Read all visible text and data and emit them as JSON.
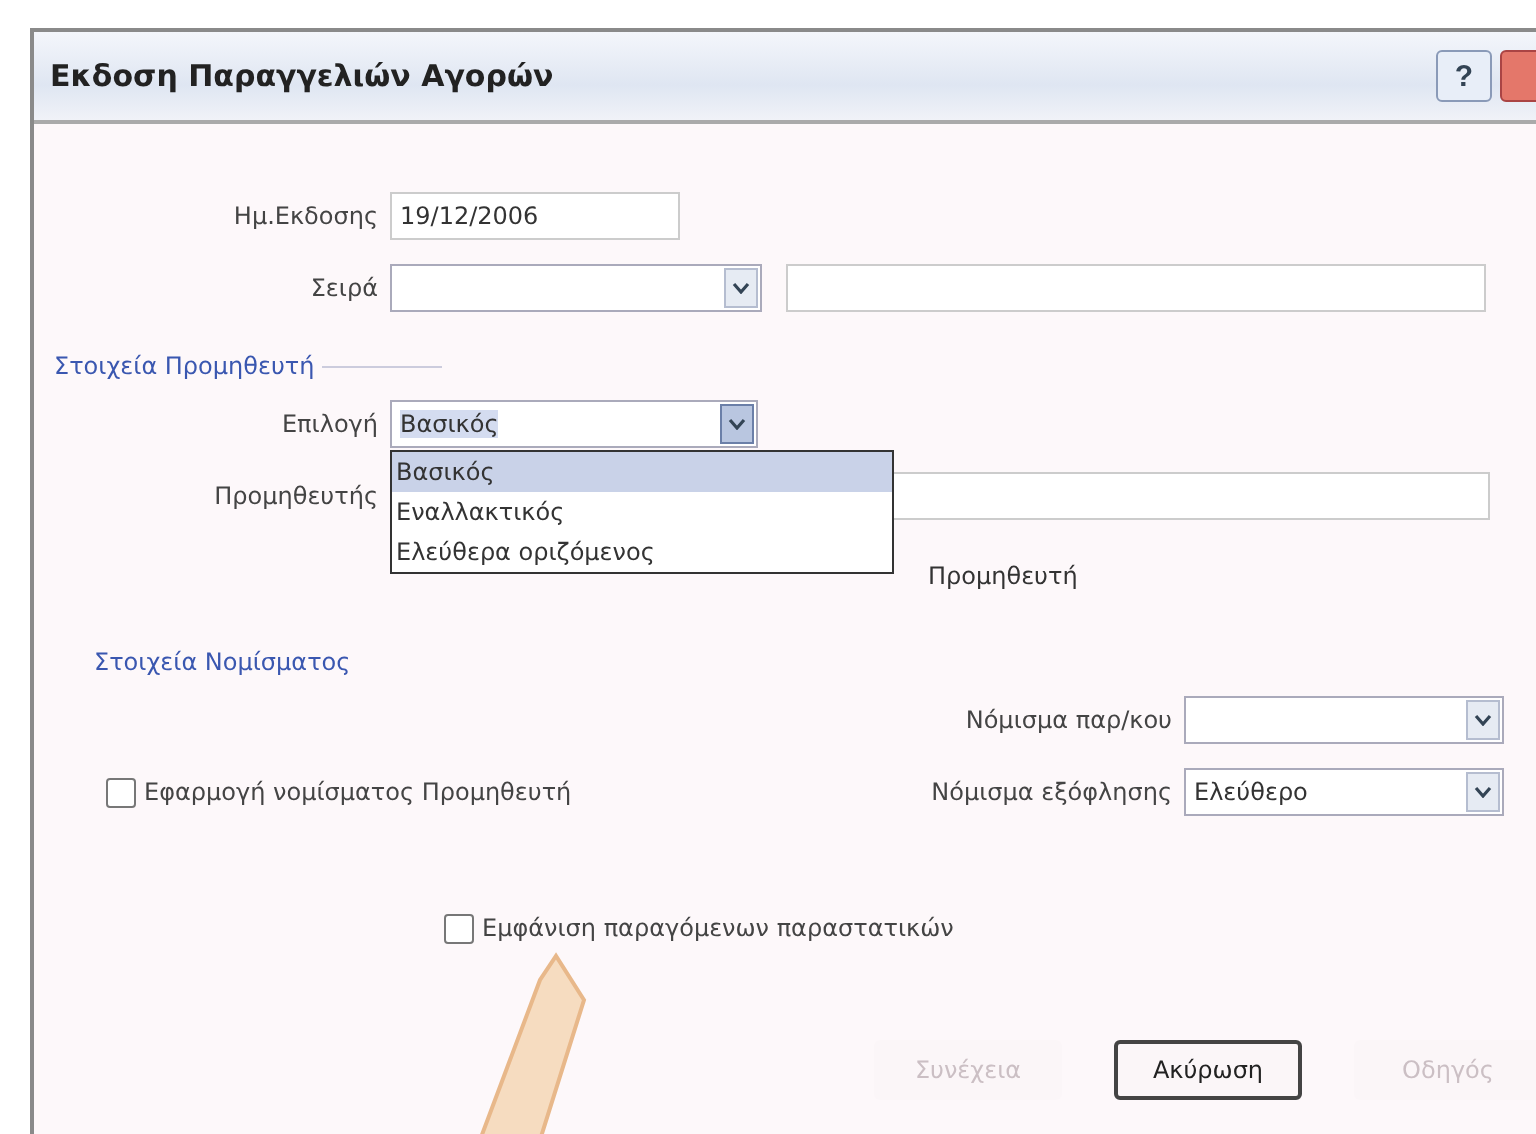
{
  "window": {
    "title": "Εκδοση Παραγγελιών Αγορών",
    "help": "?"
  },
  "issue_date": {
    "label": "Ημ.Εκδοσης",
    "value": "19/12/2006"
  },
  "series": {
    "label": "Σειρά"
  },
  "supplier_section": {
    "title": "Στοιχεία Προμηθευτή",
    "choice": {
      "label": "Επιλογή",
      "value": "Βασικός",
      "expanded": true,
      "options": [
        {
          "label": "Βασικός",
          "selected": true
        },
        {
          "label": "Εναλλακτικός",
          "selected": false
        },
        {
          "label": "Ελεύθερα οριζόμενος",
          "selected": false
        }
      ]
    },
    "supplier": {
      "label": "Προμηθευτής"
    },
    "hidden_text": "Προμηθευτή"
  },
  "currency_section": {
    "title": "Στοιχεία Νομίσματος",
    "order_currency": {
      "label": "Νόμισμα παρ/κου"
    },
    "apply_supplier_currency": {
      "label": "Εφαρμογή νομίσματος Προμηθευτή",
      "checked": false
    },
    "payment_currency": {
      "label": "Νόμισμα εξόφλησης",
      "value": "Ελεύθερο"
    }
  },
  "show_generated": {
    "label": "Εμφάνιση παραγόμενων παραστατικών",
    "checked": false
  },
  "buttons": [
    {
      "label": "Συνέχεια",
      "disabled": true
    },
    {
      "label": "Ακύρωση",
      "disabled": false
    },
    {
      "label": "Οδηγός",
      "disabled": true
    }
  ]
}
